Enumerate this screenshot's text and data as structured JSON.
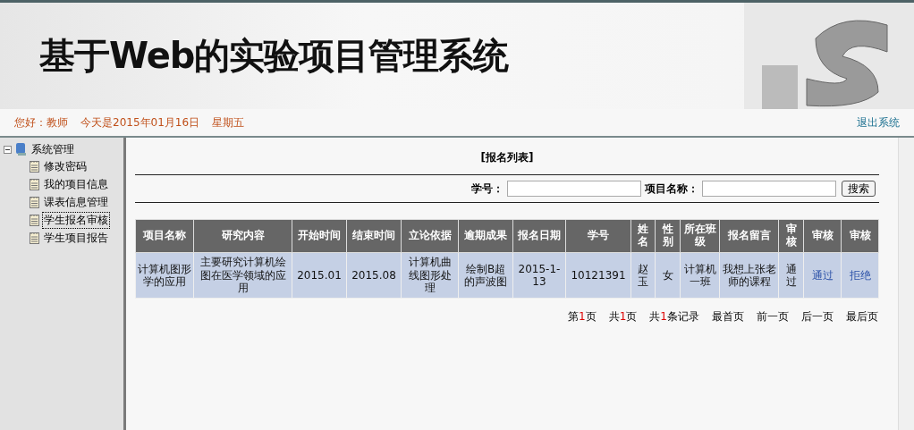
{
  "header": {
    "title": "基于Web的实验项目管理系统"
  },
  "info_bar": {
    "greeting": "您好：教师",
    "date": "今天是2015年01月16日",
    "weekday": "星期五",
    "logout": "退出系统"
  },
  "sidebar": {
    "items": [
      {
        "label": "系统管理",
        "expanded": true,
        "children": [
          {
            "label": "修改密码",
            "selected": false
          },
          {
            "label": "我的项目信息",
            "selected": false
          },
          {
            "label": "课表信息管理",
            "selected": false
          },
          {
            "label": "学生报名审核",
            "selected": true
          },
          {
            "label": "学生项目报告",
            "selected": false
          }
        ]
      }
    ]
  },
  "main": {
    "title": "[报名列表]",
    "search": {
      "fields": [
        {
          "label": "学号："
        },
        {
          "label": "项目名称："
        }
      ],
      "button": "搜索"
    },
    "table": {
      "columns": [
        "项目名称",
        "研究内容",
        "开始时间",
        "结束时间",
        "立论依据",
        "逾期成果",
        "报名日期",
        "学号",
        "姓名",
        "性别",
        "所在班级",
        "报名留言",
        "审核",
        "审核",
        "审核"
      ],
      "rows": [
        [
          {
            "kind": "text",
            "text": "计算机图形学的应用"
          },
          {
            "kind": "text",
            "text": "主要研究计算机绘图在医学领域的应用"
          },
          {
            "kind": "text",
            "text": "2015.01"
          },
          {
            "kind": "text",
            "text": "2015.08"
          },
          {
            "kind": "text",
            "text": "计算机曲线图形处理"
          },
          {
            "kind": "text",
            "text": "绘制B超的声波图"
          },
          {
            "kind": "text",
            "text": "2015-1-13"
          },
          {
            "kind": "text",
            "text": "10121391"
          },
          {
            "kind": "text",
            "text": "赵玉"
          },
          {
            "kind": "text",
            "text": "女"
          },
          {
            "kind": "text",
            "text": "计算机一班"
          },
          {
            "kind": "text",
            "text": "我想上张老师的课程"
          },
          {
            "kind": "text",
            "text": "通过"
          },
          {
            "kind": "link",
            "text": "通过"
          },
          {
            "kind": "link",
            "text": "拒绝"
          }
        ]
      ]
    },
    "pagination": [
      {
        "kind": "count",
        "before": "第",
        "number": "1",
        "after": "页"
      },
      {
        "kind": "count",
        "before": "共",
        "number": "1",
        "after": "页"
      },
      {
        "kind": "count",
        "before": "共",
        "number": "1",
        "after": "条记录"
      },
      {
        "kind": "link",
        "label": "最首页"
      },
      {
        "kind": "link",
        "label": "前一页"
      },
      {
        "kind": "link",
        "label": "后一页"
      },
      {
        "kind": "link",
        "label": "最后页"
      }
    ]
  }
}
